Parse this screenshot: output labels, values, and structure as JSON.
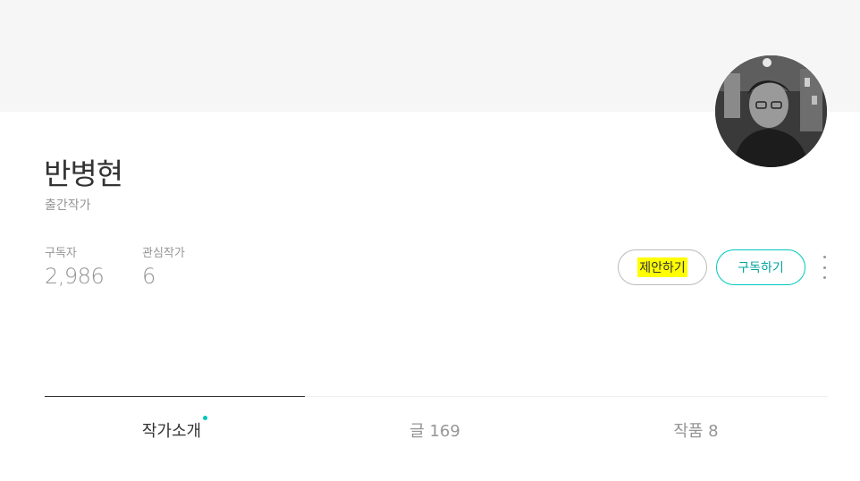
{
  "profile": {
    "name": "반병현",
    "job": "출간작가",
    "subscribers_label": "구독자",
    "subscribers_value": "2,986",
    "watching_label": "관심작가",
    "watching_value": "6"
  },
  "actions": {
    "suggest_label": "제안하기",
    "subscribe_label": "구독하기"
  },
  "tabs": [
    {
      "label": "작가소개",
      "active": true,
      "new_dot": true
    },
    {
      "label": "글 169",
      "active": false
    },
    {
      "label": "작품 8",
      "active": false
    }
  ],
  "colors": {
    "accent": "#00c6be",
    "highlight": "#ffff00",
    "cover": "#f6f6f6",
    "muted_text": "#959595"
  },
  "icons": {
    "more": "vertical-ellipsis-icon",
    "new": "new-dot-icon"
  }
}
